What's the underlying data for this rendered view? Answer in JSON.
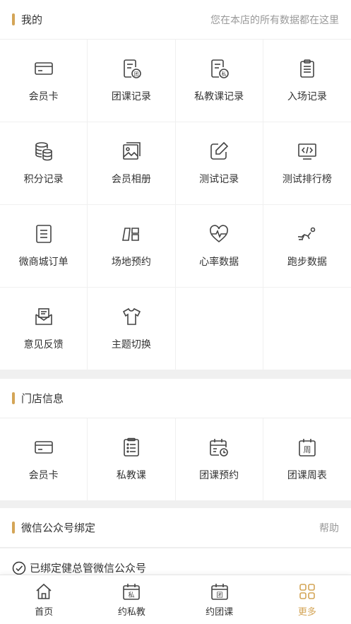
{
  "colors": {
    "accent": "#d4a557",
    "text": "#333333",
    "muted": "#999999",
    "icon": "#444444"
  },
  "mine": {
    "title": "我的",
    "note": "您在本店的所有数据都在这里",
    "items": [
      {
        "label": "会员卡",
        "icon": "card-icon"
      },
      {
        "label": "团课记录",
        "icon": "group-class-record-icon"
      },
      {
        "label": "私教课记录",
        "icon": "private-class-record-icon"
      },
      {
        "label": "入场记录",
        "icon": "clipboard-icon"
      },
      {
        "label": "积分记录",
        "icon": "coins-icon"
      },
      {
        "label": "会员相册",
        "icon": "photo-album-icon"
      },
      {
        "label": "测试记录",
        "icon": "edit-icon"
      },
      {
        "label": "测试排行榜",
        "icon": "code-screen-icon"
      },
      {
        "label": "微商城订单",
        "icon": "order-document-icon"
      },
      {
        "label": "场地预约",
        "icon": "venue-icon"
      },
      {
        "label": "心率数据",
        "icon": "heart-rate-icon"
      },
      {
        "label": "跑步数据",
        "icon": "running-icon"
      },
      {
        "label": "意见反馈",
        "icon": "feedback-mail-icon"
      },
      {
        "label": "主题切换",
        "icon": "tshirt-icon"
      }
    ]
  },
  "store": {
    "title": "门店信息",
    "items": [
      {
        "label": "会员卡",
        "icon": "card-icon"
      },
      {
        "label": "私教课",
        "icon": "list-icon"
      },
      {
        "label": "团课预约",
        "icon": "calendar-clock-icon"
      },
      {
        "label": "团课周表",
        "icon": "weekly-calendar-icon"
      }
    ]
  },
  "wechat": {
    "title": "微信公众号绑定",
    "help": "帮助",
    "status": "已绑定健总管微信公众号"
  },
  "tabbar": {
    "items": [
      {
        "label": "首页",
        "icon": "home-icon",
        "active": false
      },
      {
        "label": "约私教",
        "icon": "private-calendar-icon",
        "active": false
      },
      {
        "label": "约团课",
        "icon": "group-calendar-icon",
        "active": false
      },
      {
        "label": "更多",
        "icon": "grid-icon",
        "active": true
      }
    ],
    "private_glyph": "私",
    "group_glyph": "团"
  },
  "icon_glyphs": {
    "group": "团",
    "private": "私",
    "week": "周"
  }
}
